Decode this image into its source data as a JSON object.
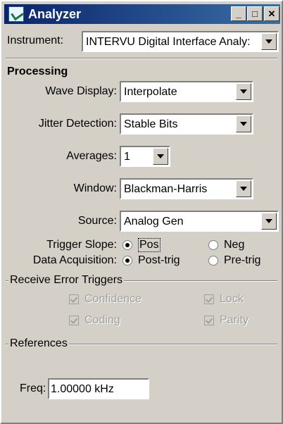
{
  "window": {
    "title": "Analyzer",
    "icon": "analyzer-app-icon",
    "controls": [
      "minimize-icon",
      "maximize-icon",
      "close-icon"
    ]
  },
  "instrument": {
    "label": "Instrument:",
    "value": "INTERVU Digital Interface Analy:"
  },
  "processing": {
    "heading": "Processing",
    "wave_display": {
      "label": "Wave Display:",
      "value": "Interpolate"
    },
    "jitter_detection": {
      "label": "Jitter Detection:",
      "value": "Stable Bits"
    },
    "averages": {
      "label": "Averages:",
      "value": "1"
    },
    "window_fn": {
      "label": "Window:",
      "value": "Blackman-Harris"
    },
    "source": {
      "label": "Source:",
      "value": "Analog Gen"
    },
    "trigger_slope": {
      "label": "Trigger Slope:",
      "option_pos": "Pos",
      "option_neg": "Neg",
      "selected": "Pos"
    },
    "data_acquisition": {
      "label": "Data Acquisition:",
      "option_post": "Post-trig",
      "option_pre": "Pre-trig",
      "selected": "Post-trig"
    }
  },
  "receive_error_triggers": {
    "title": "Receive Error Triggers",
    "items": [
      {
        "label": "Confidence",
        "checked": true,
        "enabled": false
      },
      {
        "label": "Lock",
        "checked": true,
        "enabled": false
      },
      {
        "label": "Coding",
        "checked": true,
        "enabled": false
      },
      {
        "label": "Parity",
        "checked": true,
        "enabled": false
      }
    ]
  },
  "references": {
    "title": "References",
    "freq": {
      "label": "Freq:",
      "value": "1.00000 kHz"
    }
  },
  "colors": {
    "titlebar_start": "#0a246a",
    "titlebar_end": "#3a6ea5",
    "face": "#d4d0c8",
    "disabled_text": "#a0a0a0"
  }
}
